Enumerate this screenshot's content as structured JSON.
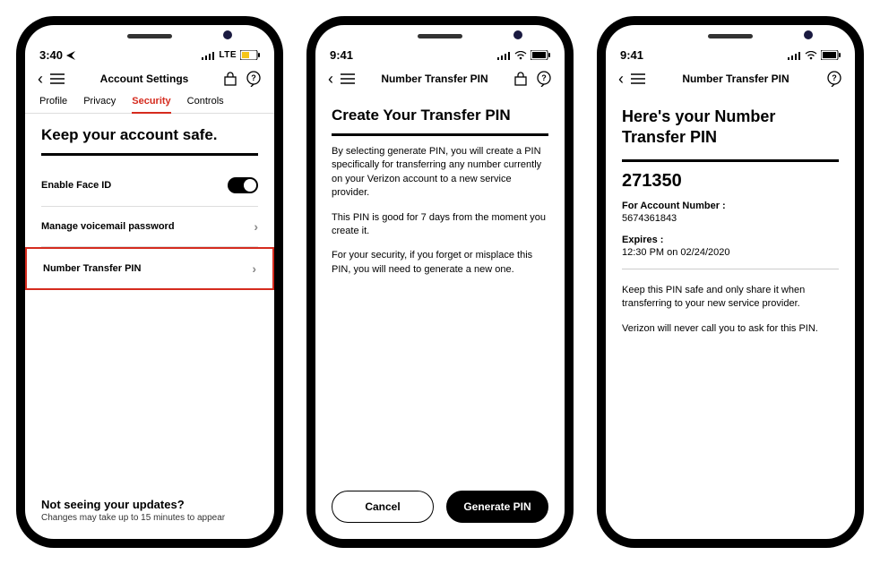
{
  "phone1": {
    "status": {
      "time": "3:40",
      "network": "LTE"
    },
    "nav": {
      "title": "Account Settings"
    },
    "tabs": [
      "Profile",
      "Privacy",
      "Security",
      "Controls"
    ],
    "active_tab": "Security",
    "heading": "Keep your account safe.",
    "row_faceid": "Enable Face ID",
    "row_voicemail": "Manage voicemail password",
    "row_transfer": "Number Transfer PIN",
    "footer_title": "Not seeing your updates?",
    "footer_sub": "Changes may take up to 15 minutes to appear"
  },
  "phone2": {
    "status": {
      "time": "9:41"
    },
    "nav": {
      "title": "Number Transfer PIN"
    },
    "heading": "Create Your Transfer PIN",
    "p1": "By selecting generate PIN, you will create a PIN specifically for transferring any number currently on your Verizon account to a new service provider.",
    "p2": "This PIN is good for 7 days from the moment you create it.",
    "p3": "For your security, if you forget or misplace this PIN, you will need to generate a new one.",
    "btn_cancel": "Cancel",
    "btn_generate": "Generate PIN"
  },
  "phone3": {
    "status": {
      "time": "9:41"
    },
    "nav": {
      "title": "Number Transfer PIN"
    },
    "heading": "Here's your Number Transfer PIN",
    "pin": "271350",
    "account_label": "For Account Number :",
    "account_value": "5674361843",
    "expires_label": "Expires :",
    "expires_value": "12:30 PM on 02/24/2020",
    "note1": "Keep this PIN safe and only share it when transferring to your new service provider.",
    "note2": "Verizon will never call you to ask for this PIN."
  }
}
